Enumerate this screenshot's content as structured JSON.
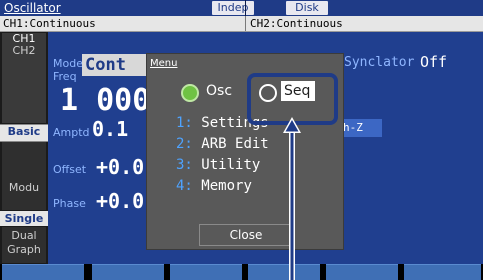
{
  "title": "Oscillator",
  "header_badges": {
    "indep": "Indep",
    "disk": "Disk"
  },
  "channels": {
    "ch1_status": "CH1:Continuous",
    "ch2_status": "CH2:Continuous"
  },
  "left_buttons": {
    "ch1": "CH1",
    "ch2": "CH2",
    "basic": "Basic",
    "modu": "Modu",
    "single": "Single",
    "dual": "Dual",
    "graph": "Graph"
  },
  "main": {
    "mode_label": "Mode",
    "mode_value": "Cont",
    "freq_label": "Freq",
    "freq_value": "1 000.",
    "amptd_label": "Amptd",
    "amptd_value": "0.1",
    "offset_label": "Offset",
    "offset_value": "+0.0",
    "phase_label": "Phase",
    "phase_value": "+0.0",
    "synclator_label": "Synclator",
    "synclator_value": "Off",
    "hiz_tag": "h-Z"
  },
  "menu": {
    "title": "Menu",
    "options": {
      "osc": "Osc",
      "seq": "Seq",
      "selected": "Osc"
    },
    "items": [
      {
        "num": "1:",
        "label": "Settings"
      },
      {
        "num": "2:",
        "label": "ARB Edit"
      },
      {
        "num": "3:",
        "label": "Utility"
      },
      {
        "num": "4:",
        "label": "Memory"
      }
    ],
    "close": "Close"
  },
  "colors": {
    "panel_blue": "#203f8f",
    "titlebar_blue": "#1f3b87",
    "menu_gray": "#595959",
    "menu_number_blue": "#4ea3ff",
    "radio_green": "#6fc243",
    "softkey_blue": "#3f6fb5",
    "annotation_blue": "#1f3b87"
  }
}
